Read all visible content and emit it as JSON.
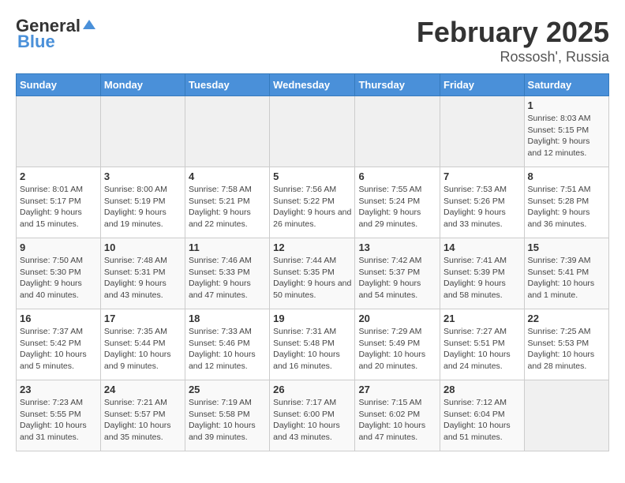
{
  "header": {
    "logo_general": "General",
    "logo_blue": "Blue",
    "main_title": "February 2025",
    "subtitle": "Rossosh', Russia"
  },
  "calendar": {
    "days_of_week": [
      "Sunday",
      "Monday",
      "Tuesday",
      "Wednesday",
      "Thursday",
      "Friday",
      "Saturday"
    ],
    "weeks": [
      [
        {
          "day": "",
          "info": ""
        },
        {
          "day": "",
          "info": ""
        },
        {
          "day": "",
          "info": ""
        },
        {
          "day": "",
          "info": ""
        },
        {
          "day": "",
          "info": ""
        },
        {
          "day": "",
          "info": ""
        },
        {
          "day": "1",
          "info": "Sunrise: 8:03 AM\nSunset: 5:15 PM\nDaylight: 9 hours and 12 minutes."
        }
      ],
      [
        {
          "day": "2",
          "info": "Sunrise: 8:01 AM\nSunset: 5:17 PM\nDaylight: 9 hours and 15 minutes."
        },
        {
          "day": "3",
          "info": "Sunrise: 8:00 AM\nSunset: 5:19 PM\nDaylight: 9 hours and 19 minutes."
        },
        {
          "day": "4",
          "info": "Sunrise: 7:58 AM\nSunset: 5:21 PM\nDaylight: 9 hours and 22 minutes."
        },
        {
          "day": "5",
          "info": "Sunrise: 7:56 AM\nSunset: 5:22 PM\nDaylight: 9 hours and 26 minutes."
        },
        {
          "day": "6",
          "info": "Sunrise: 7:55 AM\nSunset: 5:24 PM\nDaylight: 9 hours and 29 minutes."
        },
        {
          "day": "7",
          "info": "Sunrise: 7:53 AM\nSunset: 5:26 PM\nDaylight: 9 hours and 33 minutes."
        },
        {
          "day": "8",
          "info": "Sunrise: 7:51 AM\nSunset: 5:28 PM\nDaylight: 9 hours and 36 minutes."
        }
      ],
      [
        {
          "day": "9",
          "info": "Sunrise: 7:50 AM\nSunset: 5:30 PM\nDaylight: 9 hours and 40 minutes."
        },
        {
          "day": "10",
          "info": "Sunrise: 7:48 AM\nSunset: 5:31 PM\nDaylight: 9 hours and 43 minutes."
        },
        {
          "day": "11",
          "info": "Sunrise: 7:46 AM\nSunset: 5:33 PM\nDaylight: 9 hours and 47 minutes."
        },
        {
          "day": "12",
          "info": "Sunrise: 7:44 AM\nSunset: 5:35 PM\nDaylight: 9 hours and 50 minutes."
        },
        {
          "day": "13",
          "info": "Sunrise: 7:42 AM\nSunset: 5:37 PM\nDaylight: 9 hours and 54 minutes."
        },
        {
          "day": "14",
          "info": "Sunrise: 7:41 AM\nSunset: 5:39 PM\nDaylight: 9 hours and 58 minutes."
        },
        {
          "day": "15",
          "info": "Sunrise: 7:39 AM\nSunset: 5:41 PM\nDaylight: 10 hours and 1 minute."
        }
      ],
      [
        {
          "day": "16",
          "info": "Sunrise: 7:37 AM\nSunset: 5:42 PM\nDaylight: 10 hours and 5 minutes."
        },
        {
          "day": "17",
          "info": "Sunrise: 7:35 AM\nSunset: 5:44 PM\nDaylight: 10 hours and 9 minutes."
        },
        {
          "day": "18",
          "info": "Sunrise: 7:33 AM\nSunset: 5:46 PM\nDaylight: 10 hours and 12 minutes."
        },
        {
          "day": "19",
          "info": "Sunrise: 7:31 AM\nSunset: 5:48 PM\nDaylight: 10 hours and 16 minutes."
        },
        {
          "day": "20",
          "info": "Sunrise: 7:29 AM\nSunset: 5:49 PM\nDaylight: 10 hours and 20 minutes."
        },
        {
          "day": "21",
          "info": "Sunrise: 7:27 AM\nSunset: 5:51 PM\nDaylight: 10 hours and 24 minutes."
        },
        {
          "day": "22",
          "info": "Sunrise: 7:25 AM\nSunset: 5:53 PM\nDaylight: 10 hours and 28 minutes."
        }
      ],
      [
        {
          "day": "23",
          "info": "Sunrise: 7:23 AM\nSunset: 5:55 PM\nDaylight: 10 hours and 31 minutes."
        },
        {
          "day": "24",
          "info": "Sunrise: 7:21 AM\nSunset: 5:57 PM\nDaylight: 10 hours and 35 minutes."
        },
        {
          "day": "25",
          "info": "Sunrise: 7:19 AM\nSunset: 5:58 PM\nDaylight: 10 hours and 39 minutes."
        },
        {
          "day": "26",
          "info": "Sunrise: 7:17 AM\nSunset: 6:00 PM\nDaylight: 10 hours and 43 minutes."
        },
        {
          "day": "27",
          "info": "Sunrise: 7:15 AM\nSunset: 6:02 PM\nDaylight: 10 hours and 47 minutes."
        },
        {
          "day": "28",
          "info": "Sunrise: 7:12 AM\nSunset: 6:04 PM\nDaylight: 10 hours and 51 minutes."
        },
        {
          "day": "",
          "info": ""
        }
      ]
    ]
  }
}
